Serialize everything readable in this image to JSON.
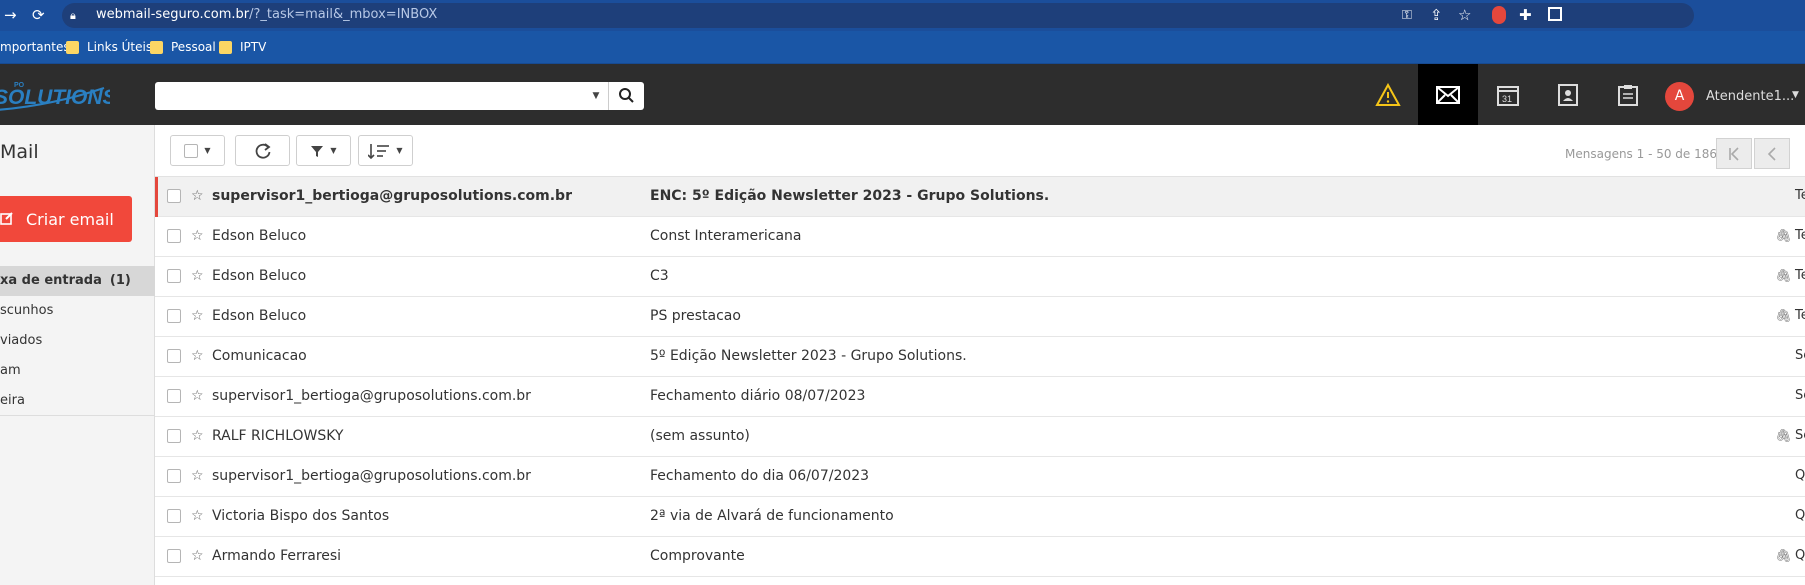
{
  "browser": {
    "url_host": "webmail-seguro.com.br",
    "url_path": "/?_task=mail&_mbox=INBOX",
    "bookmarks": [
      "mportantes",
      "Links Úteis",
      "Pessoal",
      "IPTV"
    ]
  },
  "header": {
    "logo_text": "SOLUTIONS",
    "logo_small": "PO",
    "user_initial": "A",
    "user_name": "Atendente1..."
  },
  "sidebar": {
    "title": "Mail",
    "compose_label": "Criar email",
    "folders": [
      {
        "label": "xa de entrada",
        "count": "(1)"
      },
      {
        "label": "scunhos"
      },
      {
        "label": "viados"
      },
      {
        "label": "am"
      },
      {
        "label": "eira"
      }
    ]
  },
  "toolbar": {
    "message_count": "Mensagens 1 - 50 de 186"
  },
  "messages": [
    {
      "sender": "supervisor1_bertioga@gruposolutions.com.br",
      "subject": "ENC: 5º Edição Newsletter 2023 - Grupo Solutions.",
      "date": "Te",
      "unread": true,
      "attachment": false
    },
    {
      "sender": "Edson Beluco",
      "subject": "Const Interamericana",
      "date": "Te",
      "unread": false,
      "attachment": true
    },
    {
      "sender": "Edson Beluco",
      "subject": "C3",
      "date": "Te",
      "unread": false,
      "attachment": true
    },
    {
      "sender": "Edson Beluco",
      "subject": "PS prestacao",
      "date": "Te",
      "unread": false,
      "attachment": true
    },
    {
      "sender": "Comunicacao",
      "subject": "5º Edição Newsletter 2023 - Grupo Solutions.",
      "date": "Se",
      "unread": false,
      "attachment": false
    },
    {
      "sender": "supervisor1_bertioga@gruposolutions.com.br",
      "subject": "Fechamento diário 08/07/2023",
      "date": "Se",
      "unread": false,
      "attachment": false
    },
    {
      "sender": "RALF RICHLOWSKY",
      "subject": "(sem assunto)",
      "date": "Se",
      "unread": false,
      "attachment": true
    },
    {
      "sender": "supervisor1_bertioga@gruposolutions.com.br",
      "subject": "Fechamento do dia 06/07/2023",
      "date": "Q",
      "unread": false,
      "attachment": false
    },
    {
      "sender": "Victoria Bispo dos Santos",
      "subject": "2ª via de Alvará de funcionamento",
      "date": "Q",
      "unread": false,
      "attachment": false
    },
    {
      "sender": "Armando Ferraresi",
      "subject": "Comprovante",
      "date": "Q",
      "unread": false,
      "attachment": true
    }
  ],
  "colors": {
    "accent": "#f1483b",
    "header_bg": "#2d2d2d",
    "browser_bg": "#1a56a6"
  }
}
